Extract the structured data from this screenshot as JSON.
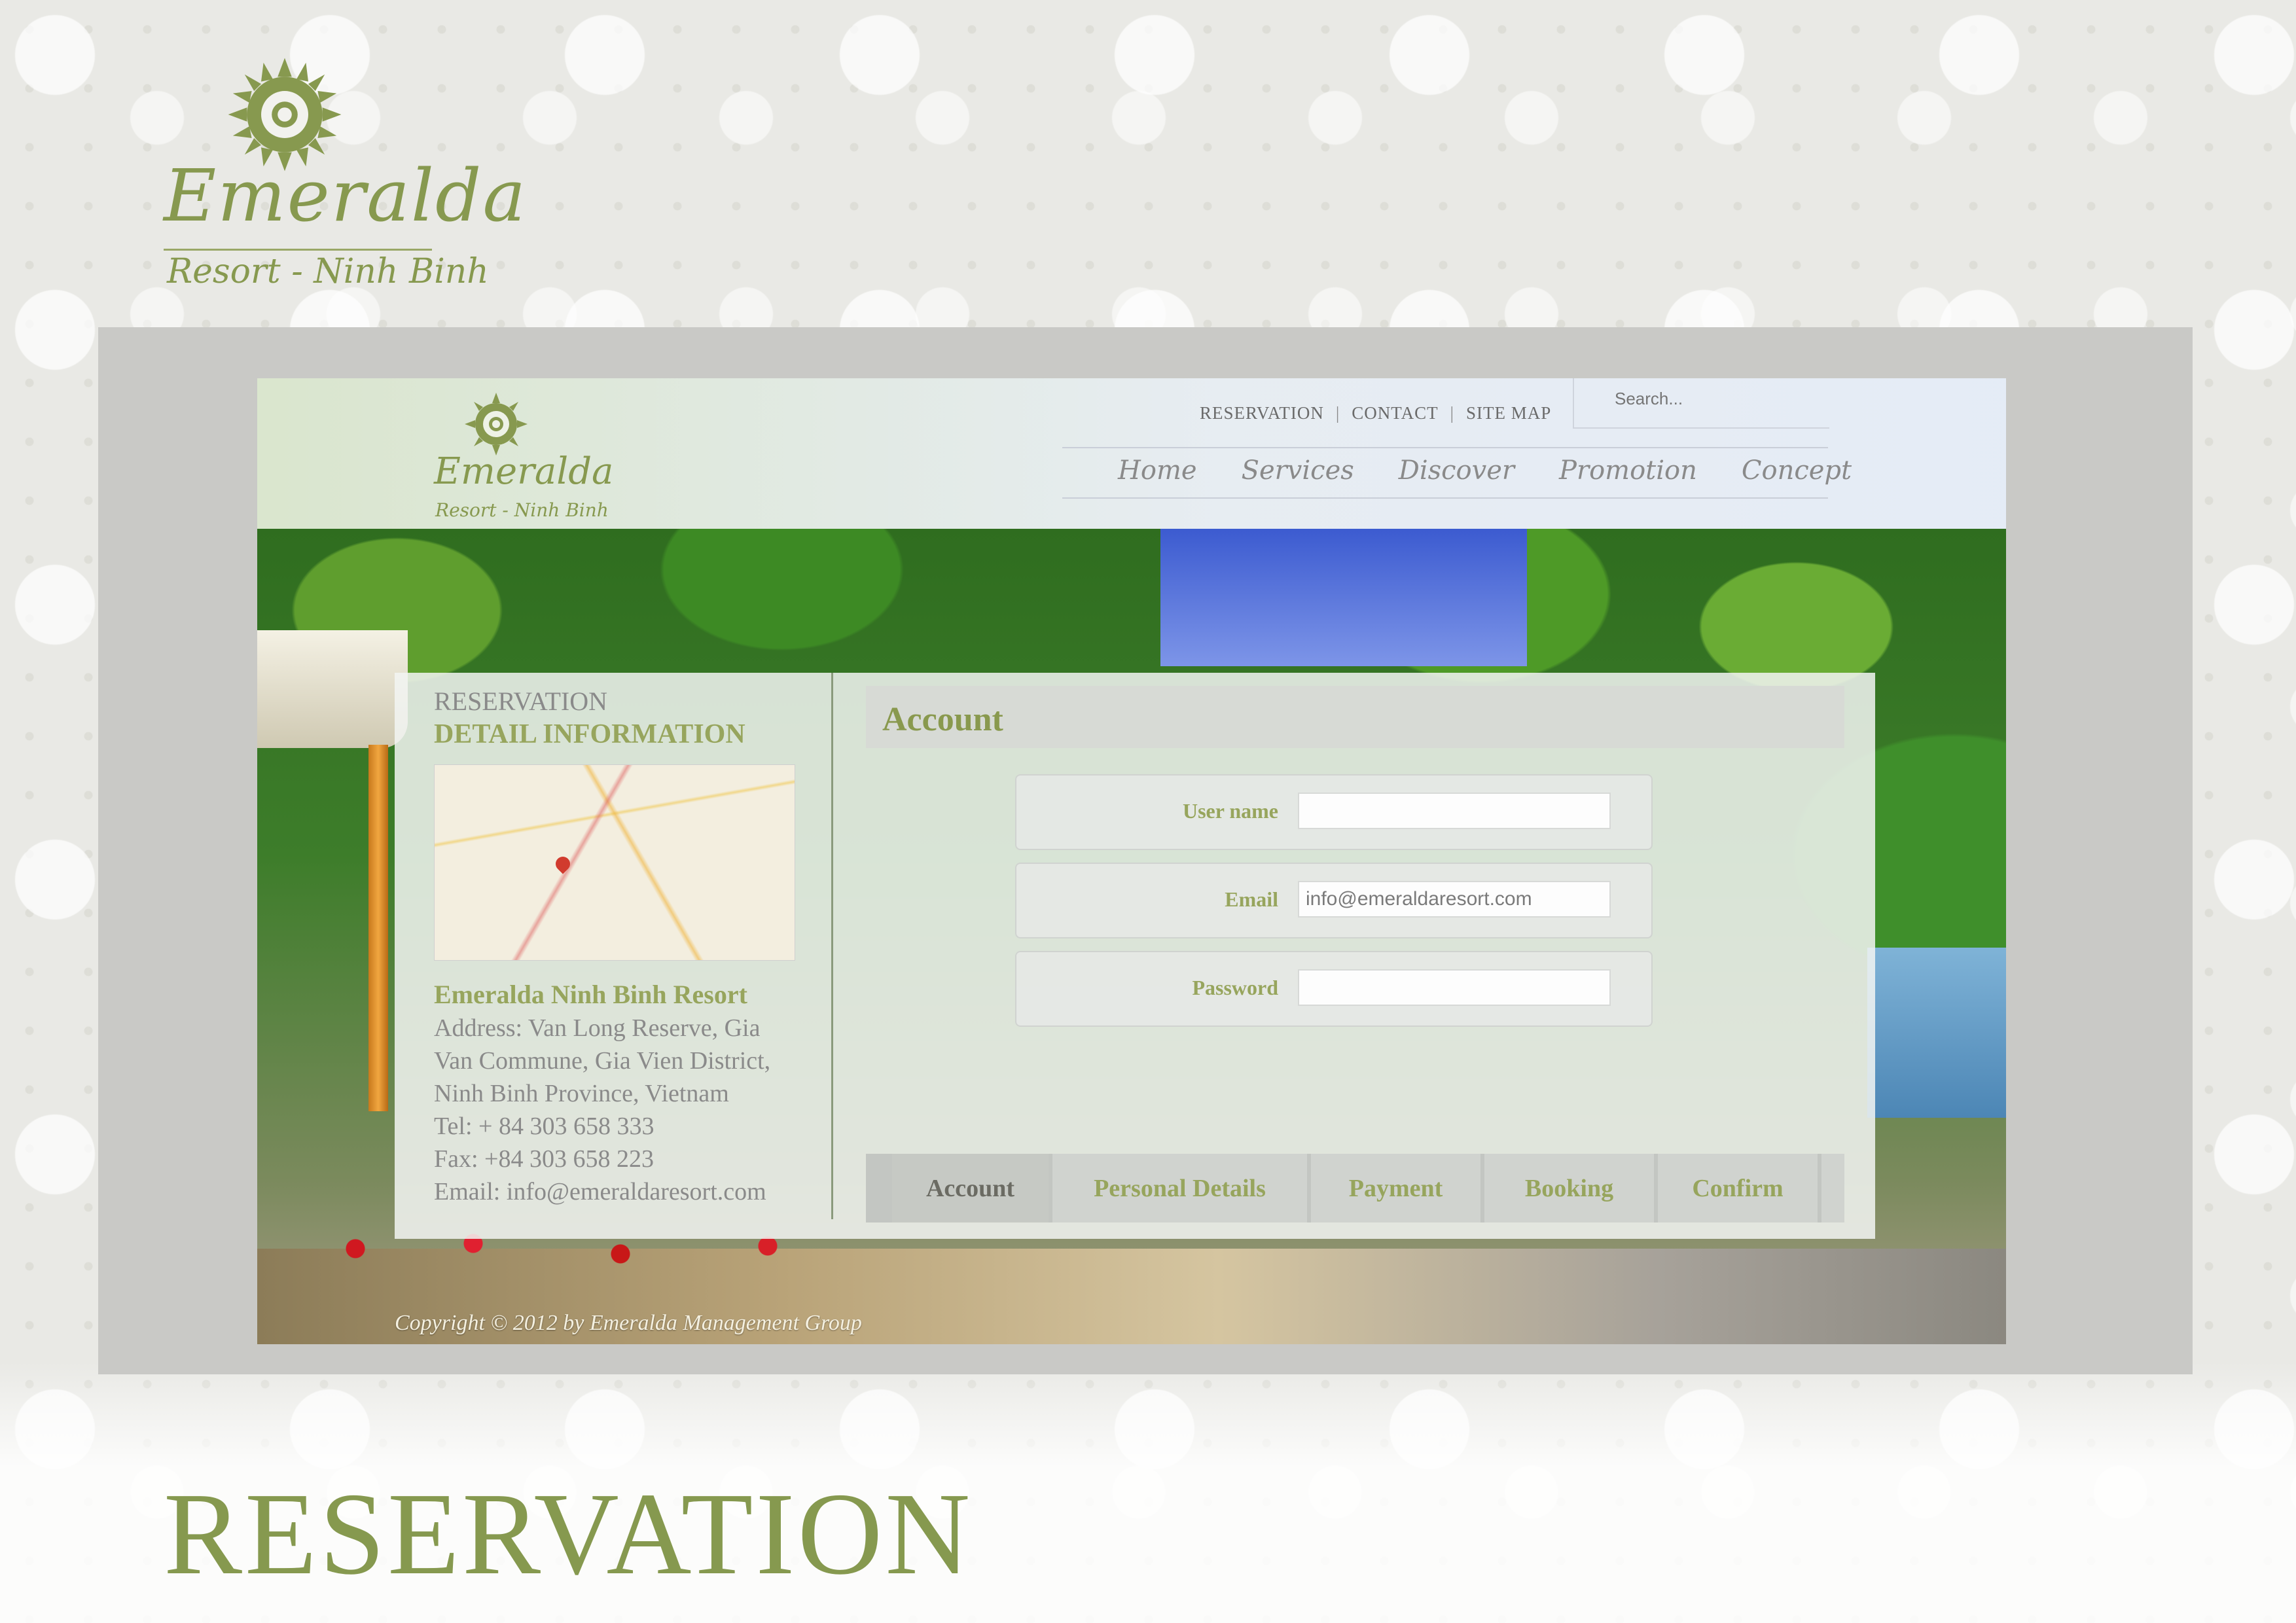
{
  "page": {
    "brand": "Emeralda",
    "brand_sub": "Resort - Ninh Binh",
    "title": "RESERVATION"
  },
  "site": {
    "logo_brand": "Emeralda",
    "logo_sub": "Resort - Ninh Binh",
    "top_links": [
      "RESERVATION",
      "CONTACT",
      "SITE MAP"
    ],
    "top_link_separator": "|",
    "search": {
      "placeholder": "Search..."
    },
    "nav": [
      "Home",
      "Services",
      "Discover",
      "Promotion",
      "Concept"
    ],
    "copyright": "Copyright © 2012 by Emeralda Management Group"
  },
  "sidebar": {
    "title": "RESERVATION",
    "subtitle": "DETAIL INFORMATION",
    "resort_name": "Emeralda Ninh Binh Resort",
    "address_lines": [
      "Address: Van Long Reserve, Gia",
      "Van Commune, Gia Vien District,",
      "Ninh Binh Province, Vietnam",
      "Tel: + 84 303 658 333",
      "Fax: +84 303 658 223",
      "Email: info@emeraldaresort.com"
    ]
  },
  "form": {
    "title": "Account",
    "fields": [
      {
        "label": "User name",
        "value": ""
      },
      {
        "label": "Email",
        "value": "info@emeraldaresort.com"
      },
      {
        "label": "Password",
        "value": ""
      }
    ]
  },
  "steps": [
    "Account",
    "Personal Details",
    "Payment",
    "Booking",
    "Confirm"
  ],
  "active_step": "Account",
  "colors": {
    "accent_green": "#87994f",
    "panel": "#f2f4f2",
    "frame": "#c9c9c6"
  },
  "icons": [
    "emeralda-sun-logo",
    "map-pin-icon"
  ]
}
